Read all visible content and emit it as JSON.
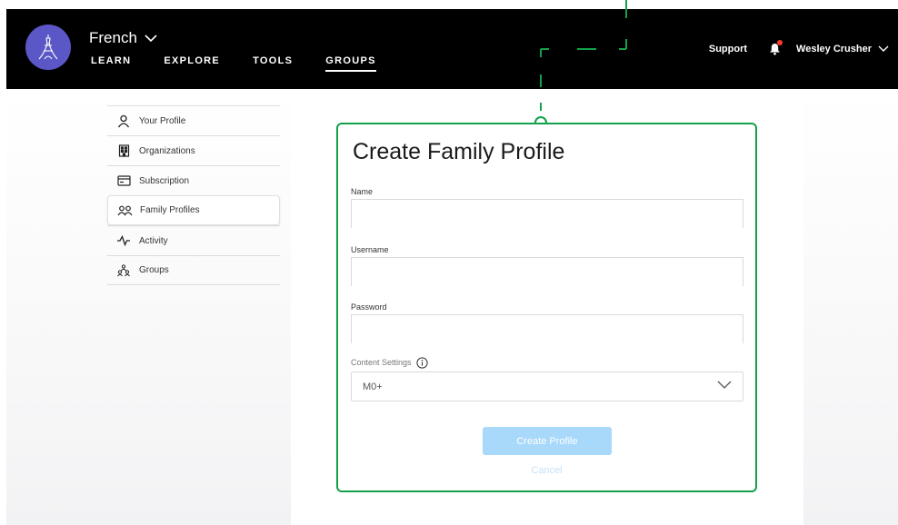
{
  "header": {
    "language": "French",
    "nav": [
      {
        "label": "LEARN",
        "active": false
      },
      {
        "label": "EXPLORE",
        "active": false
      },
      {
        "label": "TOOLS",
        "active": false
      },
      {
        "label": "GROUPS",
        "active": true
      }
    ],
    "support_label": "Support",
    "user_name": "Wesley Crusher",
    "icons": {
      "logo": "eiffel-tower-icon",
      "language_toggle": "chevron-down-icon",
      "notifications": "bell-icon",
      "user_menu": "chevron-down-icon"
    }
  },
  "sidebar": {
    "items": [
      {
        "label": "Your Profile",
        "icon": "person-icon",
        "active": false
      },
      {
        "label": "Organizations",
        "icon": "building-icon",
        "active": false
      },
      {
        "label": "Subscription",
        "icon": "card-icon",
        "active": false
      },
      {
        "label": "Family Profiles",
        "icon": "people-icon",
        "active": true
      },
      {
        "label": "Activity",
        "icon": "pulse-icon",
        "active": false
      },
      {
        "label": "Groups",
        "icon": "group-icon",
        "active": false
      }
    ]
  },
  "form": {
    "title": "Create Family Profile",
    "name_label": "Name",
    "name_value": "",
    "username_label": "Username",
    "username_value": "",
    "password_label": "Password",
    "password_value": "",
    "content_label": "Content Settings",
    "content_value": "M0+",
    "submit_label": "Create Profile",
    "cancel_label": "Cancel"
  },
  "colors": {
    "accent_green": "#12a14a",
    "logo_purple": "#5b57c6",
    "button_disabled_blue": "#a8d8fa",
    "notification_red": "#ff3b30",
    "header_bg": "#000000"
  }
}
